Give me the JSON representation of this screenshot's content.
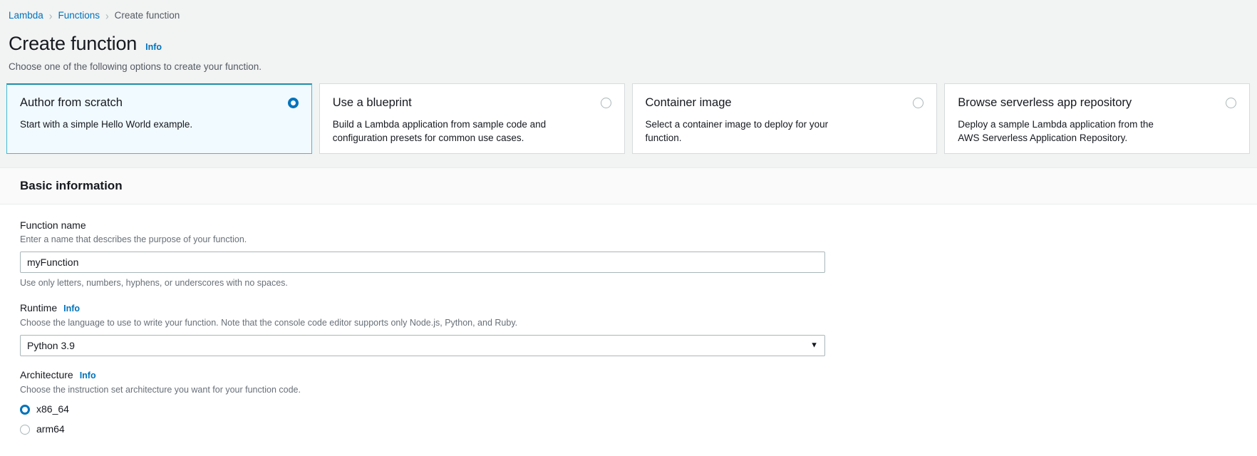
{
  "breadcrumb": {
    "items": [
      {
        "label": "Lambda",
        "current": false
      },
      {
        "label": "Functions",
        "current": false
      },
      {
        "label": "Create function",
        "current": true
      }
    ],
    "separator": "›"
  },
  "page": {
    "title": "Create function",
    "info_label": "Info",
    "subtitle": "Choose one of the following options to create your function."
  },
  "creation_options": [
    {
      "title": "Author from scratch",
      "description": "Start with a simple Hello World example.",
      "selected": true
    },
    {
      "title": "Use a blueprint",
      "description": "Build a Lambda application from sample code and configuration presets for common use cases.",
      "selected": false
    },
    {
      "title": "Container image",
      "description": "Select a container image to deploy for your function.",
      "selected": false
    },
    {
      "title": "Browse serverless app repository",
      "description": "Deploy a sample Lambda application from the AWS Serverless Application Repository.",
      "selected": false
    }
  ],
  "basic_information": {
    "heading": "Basic information",
    "function_name": {
      "label": "Function name",
      "description": "Enter a name that describes the purpose of your function.",
      "value": "myFunction",
      "placeholder": "",
      "hint": "Use only letters, numbers, hyphens, or underscores with no spaces."
    },
    "runtime": {
      "label": "Runtime",
      "info_label": "Info",
      "description": "Choose the language to use to write your function. Note that the console code editor supports only Node.js, Python, and Ruby.",
      "selected": "Python 3.9",
      "caret_icon": "▼"
    },
    "architecture": {
      "label": "Architecture",
      "info_label": "Info",
      "description": "Choose the instruction set architecture you want for your function code.",
      "options": [
        {
          "label": "x86_64",
          "selected": true
        },
        {
          "label": "arm64",
          "selected": false
        }
      ]
    }
  },
  "colors": {
    "link": "#0073bb",
    "selected_tile_bg": "#f1faff",
    "selected_tile_border": "#44b9d6",
    "selected_tile_top": "#1d8eaa",
    "page_bg": "#f2f3f3"
  }
}
